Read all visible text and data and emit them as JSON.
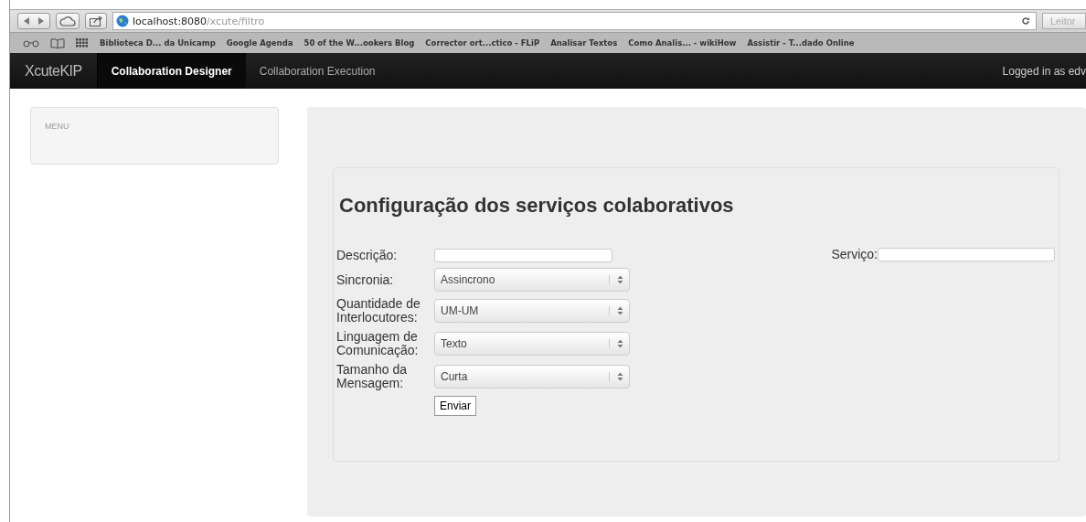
{
  "browser": {
    "url_host": "localhost:8080",
    "url_path": "/xcute/filtro",
    "reader_button": "Leitor",
    "bookmarks": [
      "Biblioteca D... da Unicamp",
      "Google Agenda",
      "50 of the W...ookers Blog",
      "Corrector ort...ctico - FLiP",
      "Analisar Textos",
      "Como Analis... - wikiHow",
      "Assistir - T...dado Online"
    ]
  },
  "navbar": {
    "brand": "XcuteKIP",
    "tabs": [
      {
        "label": "Collaboration Designer",
        "selected": true
      },
      {
        "label": "Collaboration Execution",
        "selected": false
      }
    ],
    "user": "Logged in as edv"
  },
  "sidebar": {
    "heading": "MENU"
  },
  "form": {
    "title": "Configuração dos serviços colaborativos",
    "fields": [
      {
        "kind": "text",
        "label": "Descrição:"
      },
      {
        "kind": "select",
        "label": "Sincronia:",
        "value": "Assincrono"
      },
      {
        "kind": "select",
        "label": "Quantidade de Interlocutores:",
        "value": "UM-UM"
      },
      {
        "kind": "select",
        "label": "Linguagem de Comunicação:",
        "value": "Texto"
      },
      {
        "kind": "select",
        "label": "Tamanho da Mensagem:",
        "value": "Curta"
      }
    ],
    "service": {
      "label": "Serviço:"
    },
    "submit": "Enviar"
  }
}
